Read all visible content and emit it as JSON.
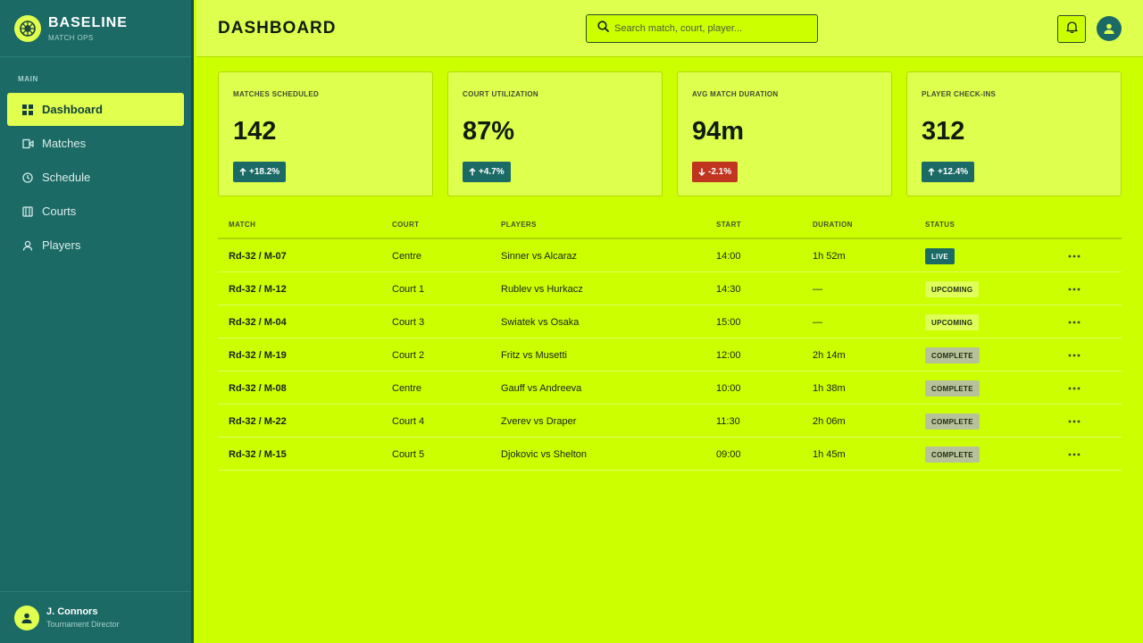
{
  "brand": {
    "name": "BASELINE",
    "subtitle": "MATCH OPS"
  },
  "sidebar": {
    "section_label": "MAIN",
    "items": [
      {
        "label": "Dashboard",
        "icon": "grid-icon",
        "active": true
      },
      {
        "label": "Matches",
        "icon": "video-icon",
        "active": false
      },
      {
        "label": "Schedule",
        "icon": "clock-icon",
        "active": false
      },
      {
        "label": "Courts",
        "icon": "court-icon",
        "active": false
      },
      {
        "label": "Players",
        "icon": "user-icon",
        "active": false
      }
    ],
    "user": {
      "name": "J. Connors",
      "role": "Tournament Director"
    }
  },
  "header": {
    "title": "DASHBOARD",
    "search_placeholder": "Search match, court, player..."
  },
  "kpis": [
    {
      "label": "MATCHES SCHEDULED",
      "value": "142",
      "delta": "+18.2%",
      "direction": "up"
    },
    {
      "label": "COURT UTILIZATION",
      "value": "87%",
      "delta": "+4.7%",
      "direction": "up"
    },
    {
      "label": "AVG MATCH DURATION",
      "value": "94m",
      "delta": "-2.1%",
      "direction": "down"
    },
    {
      "label": "PLAYER CHECK-INS",
      "value": "312",
      "delta": "+12.4%",
      "direction": "up"
    }
  ],
  "table": {
    "columns": [
      "MATCH",
      "COURT",
      "PLAYERS",
      "START",
      "DURATION",
      "STATUS"
    ],
    "rows": [
      {
        "match": "Rd-32 / M-07",
        "court": "Centre",
        "players": "Sinner vs Alcaraz",
        "start": "14:00",
        "duration": "1h 52m",
        "status": "LIVE",
        "status_type": "live"
      },
      {
        "match": "Rd-32 / M-12",
        "court": "Court 1",
        "players": "Rublev vs Hurkacz",
        "start": "14:30",
        "duration": "—",
        "status": "UPCOMING",
        "status_type": "upcoming"
      },
      {
        "match": "Rd-32 / M-04",
        "court": "Court 3",
        "players": "Swiatek vs Osaka",
        "start": "15:00",
        "duration": "—",
        "status": "UPCOMING",
        "status_type": "upcoming"
      },
      {
        "match": "Rd-32 / M-19",
        "court": "Court 2",
        "players": "Fritz vs Musetti",
        "start": "12:00",
        "duration": "2h 14m",
        "status": "COMPLETE",
        "status_type": "complete"
      },
      {
        "match": "Rd-32 / M-08",
        "court": "Centre",
        "players": "Gauff vs Andreeva",
        "start": "10:00",
        "duration": "1h 38m",
        "status": "COMPLETE",
        "status_type": "complete"
      },
      {
        "match": "Rd-32 / M-22",
        "court": "Court 4",
        "players": "Zverev vs Draper",
        "start": "11:30",
        "duration": "2h 06m",
        "status": "COMPLETE",
        "status_type": "complete"
      },
      {
        "match": "Rd-32 / M-15",
        "court": "Court 5",
        "players": "Djokovic vs Shelton",
        "start": "09:00",
        "duration": "1h 45m",
        "status": "COMPLETE",
        "status_type": "complete"
      }
    ]
  },
  "colors": {
    "accent": "#ccff00",
    "sidebar": "#1b6a66",
    "highlight": "#e0ff4f",
    "negative": "#c0351f"
  }
}
